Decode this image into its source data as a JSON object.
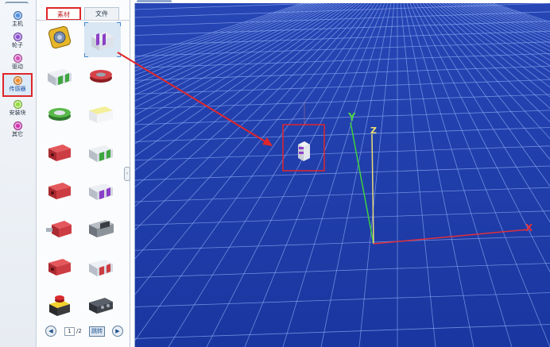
{
  "sidebar": {
    "categories": [
      {
        "label": "主机",
        "color": "#4f8fe0"
      },
      {
        "label": "轮子",
        "color": "#8b4fd0"
      },
      {
        "label": "驱动",
        "color": "#d250b8"
      },
      {
        "label": "传感器",
        "color": "#f28a2a",
        "active": true
      },
      {
        "label": "安装块",
        "color": "#93d93a"
      },
      {
        "label": "其它",
        "color": "#d033b0"
      }
    ]
  },
  "panel": {
    "tabs": [
      {
        "label": "素材",
        "active": true
      },
      {
        "label": "文件"
      }
    ],
    "items": [
      {
        "icon": "coin-part-icon",
        "selected": false
      },
      {
        "icon": "purple-block-icon",
        "selected": true
      },
      {
        "icon": "green-block-icon"
      },
      {
        "icon": "red-disc-icon"
      },
      {
        "icon": "green-disc-icon"
      },
      {
        "icon": "yellow-block-icon"
      },
      {
        "icon": "red-block-icon"
      },
      {
        "icon": "green-block-icon"
      },
      {
        "icon": "red-block-icon"
      },
      {
        "icon": "purple-block-icon"
      },
      {
        "icon": "red-block-icon"
      },
      {
        "icon": "motor-icon"
      },
      {
        "icon": "red-block-icon"
      },
      {
        "icon": "red-block-icon"
      },
      {
        "icon": "estop-button-icon"
      },
      {
        "icon": "dark-sensor-icon"
      }
    ],
    "pager": {
      "prev": "◀",
      "next": "▶",
      "page": "1",
      "total": "2",
      "jump": "跳转"
    }
  },
  "viewport": {
    "axis_x": "X",
    "axis_y": "Y",
    "axis_z": "Z",
    "background": "#1c3aa3",
    "grid_color": "#8aa6f0",
    "highlight_color": "#e0262a"
  }
}
